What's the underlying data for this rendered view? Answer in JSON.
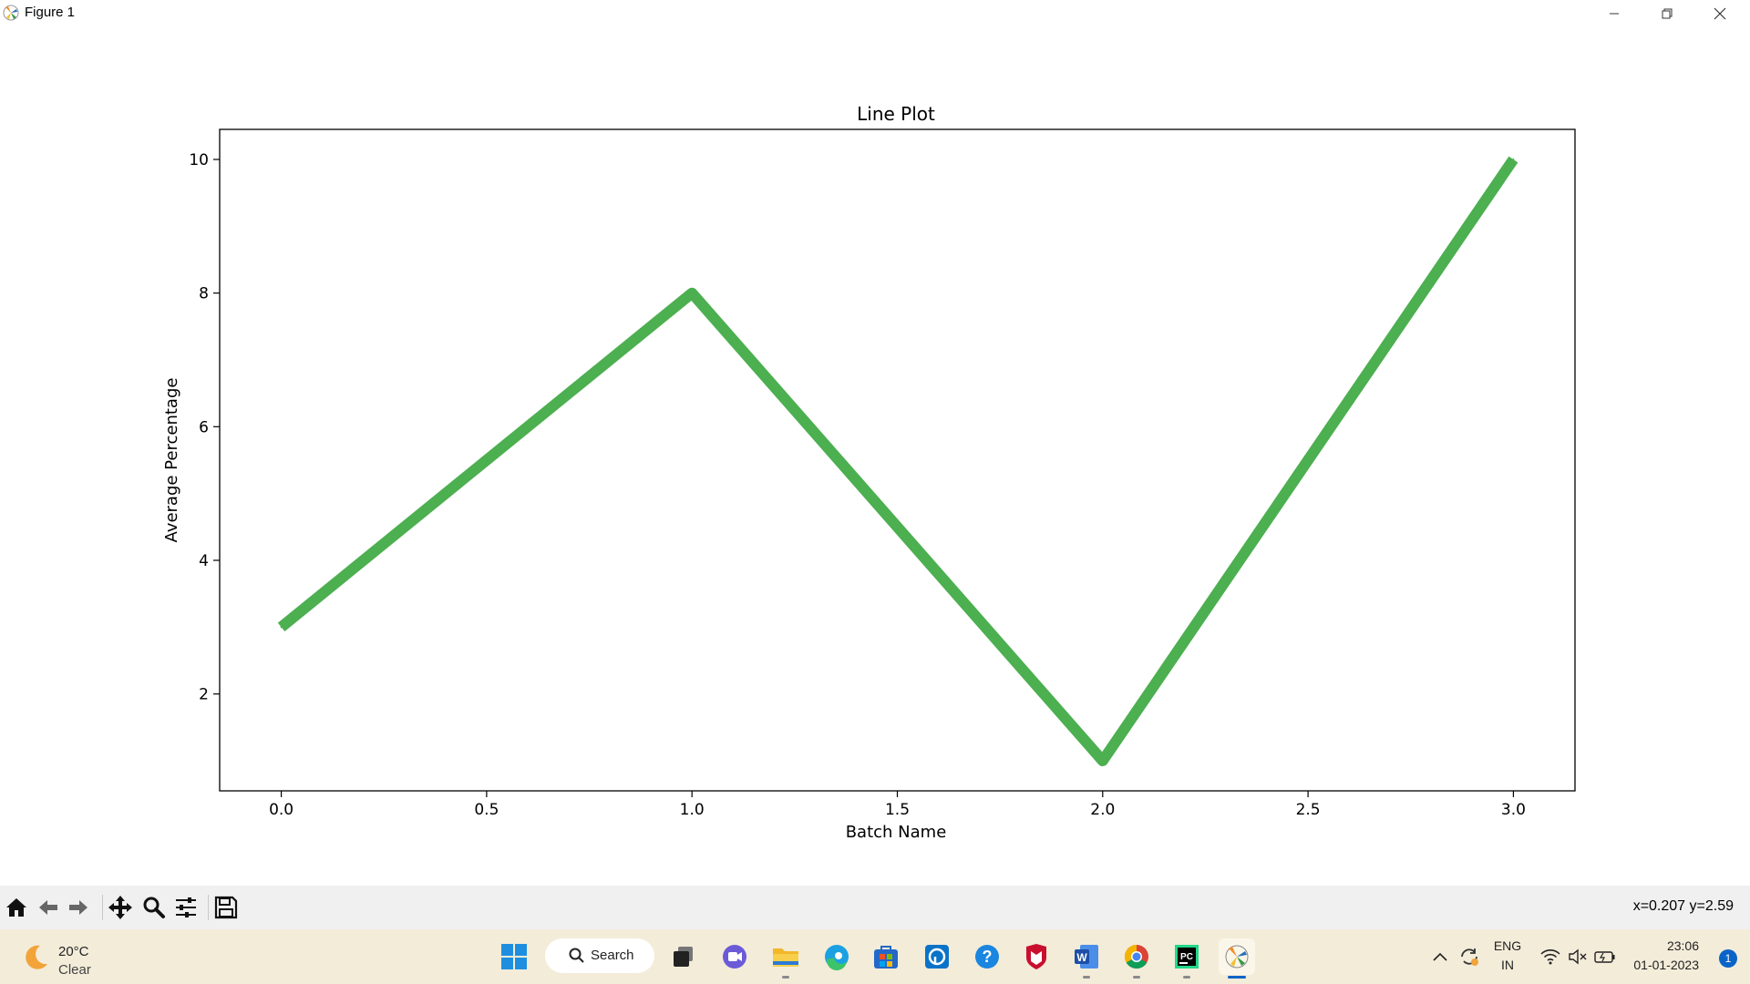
{
  "window": {
    "title": "Figure 1",
    "controls": [
      "minimize-icon",
      "restore-icon",
      "close-icon"
    ]
  },
  "chart_data": {
    "type": "line",
    "title": "Line Plot",
    "xlabel": "Batch Name",
    "ylabel": "Average Percentage",
    "x": [
      0,
      1,
      2,
      3
    ],
    "y": [
      3,
      8,
      1,
      10
    ],
    "line_color": "#4caf50",
    "xlim": [
      -0.15,
      3.15
    ],
    "ylim": [
      0.55,
      10.45
    ],
    "xticks": [
      0.0,
      0.5,
      1.0,
      1.5,
      2.0,
      2.5,
      3.0
    ],
    "xtick_labels": [
      "0.0",
      "0.5",
      "1.0",
      "1.5",
      "2.0",
      "2.5",
      "3.0"
    ],
    "yticks": [
      2,
      4,
      6,
      8,
      10
    ],
    "ytick_labels": [
      "2",
      "4",
      "6",
      "8",
      "10"
    ],
    "grid": false,
    "legend": false
  },
  "toolbar": {
    "buttons": [
      "home-icon",
      "back-icon",
      "forward-icon",
      "pan-icon",
      "zoom-icon",
      "configure-subplots-icon",
      "save-icon"
    ],
    "coordinates": "x=0.207 y=2.59"
  },
  "taskbar": {
    "weather": {
      "temp": "20°C",
      "condition": "Clear",
      "icon": "moon-icon"
    },
    "search_label": "Search",
    "apps": [
      "windows-start-icon",
      "task-view-icon",
      "chat-icon",
      "file-explorer-icon",
      "edge-icon",
      "store-icon",
      "app-icon",
      "help-icon",
      "mcafee-icon",
      "word-icon",
      "chrome-icon",
      "pycharm-icon",
      "matplotlib-icon"
    ],
    "tray": {
      "language_line1": "ENG",
      "language_line2": "IN",
      "time": "23:06",
      "date": "01-01-2023",
      "notification_count": "1"
    },
    "colors": {
      "accent": "#0a64c8",
      "background": "#f3ecd9"
    }
  }
}
